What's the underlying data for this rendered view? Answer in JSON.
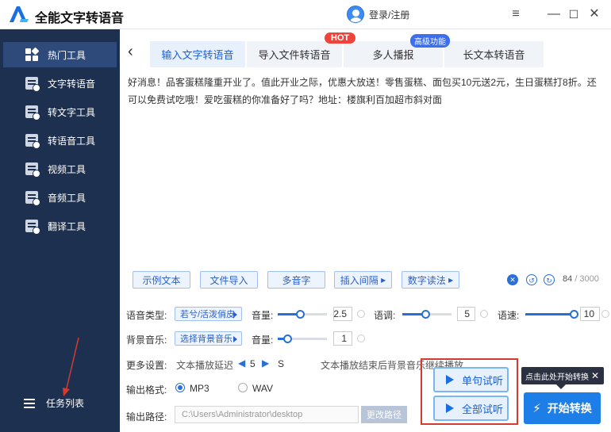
{
  "app": {
    "title": "全能文字转语音",
    "user_label": "登录/注册"
  },
  "sidebar": {
    "items": [
      {
        "label": "热门工具"
      },
      {
        "label": "文字转语音"
      },
      {
        "label": "转文字工具"
      },
      {
        "label": "转语音工具"
      },
      {
        "label": "视频工具"
      },
      {
        "label": "音频工具"
      },
      {
        "label": "翻译工具"
      }
    ],
    "task_list": "任务列表"
  },
  "tabs": [
    {
      "label": "输入文字转语音"
    },
    {
      "label": "导入文件转语音"
    },
    {
      "label": "多人播报"
    },
    {
      "label": "长文本转语音"
    }
  ],
  "badges": {
    "hot": "HOT",
    "advanced": "高级功能"
  },
  "editor": {
    "content": "好消息！品客蛋糕隆重开业了。值此开业之际，优惠大放送！零售蛋糕、面包买10元送2元，生日蛋糕打8折。还可以免费试吃哦！爱吃蛋糕的你准备好了吗？地址：楼旗利百加超市斜对面"
  },
  "toolbar": {
    "sample_text": "示例文本",
    "file_import": "文件导入",
    "polyphone": "多音字",
    "insert_pause": "插入间隔",
    "number_reading": "数字读法",
    "count": "84",
    "count_max": "/ 3000"
  },
  "settings": {
    "voice_type_label": "语音类型:",
    "voice_type_value": "若兮/活泼俏皮",
    "volume_label": "音量:",
    "volume_value": "2.5",
    "pitch_label": "语调:",
    "pitch_value": "5",
    "speed_label": "语速:",
    "speed_value": "10",
    "bgm_label": "背景音乐:",
    "bgm_value": "选择背景音乐",
    "bgm_volume_label": "音量:",
    "bgm_volume_value": "1",
    "more_label": "更多设置:",
    "delay_label": "文本播放延迟",
    "delay_value": "5",
    "delay_unit": "S",
    "after_label": "文本播放结束后背景音乐继续播放",
    "format_label": "输出格式:",
    "format_mp3": "MP3",
    "format_wav": "WAV",
    "path_label": "输出路径:",
    "path_value": "C:\\Users\\Administrator\\desktop",
    "change_path": "更改路径"
  },
  "actions": {
    "single_listen": "单句试听",
    "all_listen": "全部试听",
    "start": "开始转换",
    "tooltip": "点击此处开始转换"
  },
  "colors": {
    "sidebar_bg": "#1e3050",
    "accent": "#1e7ee8",
    "hot": "#f0443a",
    "highlight_box": "#d43b30"
  }
}
